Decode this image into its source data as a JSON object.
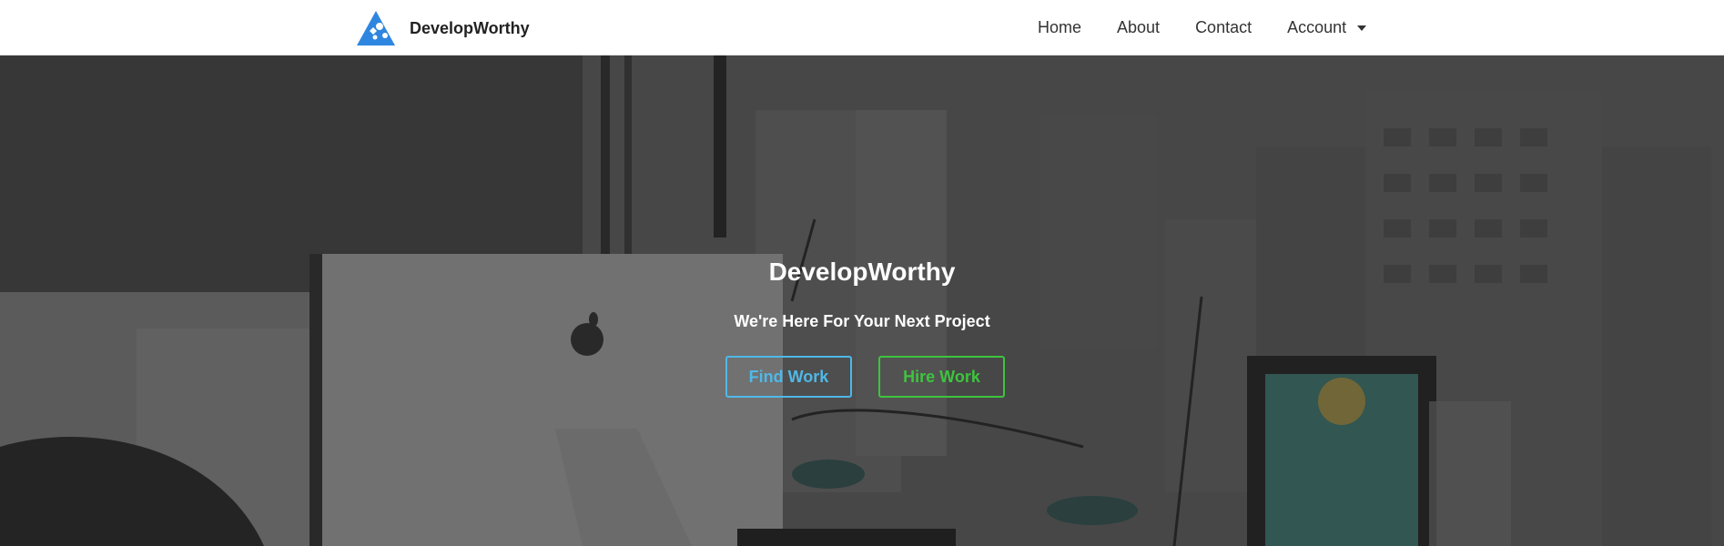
{
  "navbar": {
    "brand_name": "DevelopWorthy",
    "logo_icon": "puzzle-triangle-logo",
    "brand_color": "#2f86e0",
    "links": [
      {
        "label": "Home"
      },
      {
        "label": "About"
      },
      {
        "label": "Contact"
      },
      {
        "label": "Account",
        "has_dropdown": true
      }
    ]
  },
  "hero": {
    "title": "DevelopWorthy",
    "subtitle": "We're Here For Your Next Project",
    "background_description_icon": "office-desk-photo",
    "buttons": {
      "find_work": {
        "label": "Find Work",
        "color": "#4fb8e8"
      },
      "hire_work": {
        "label": "Hire Work",
        "color": "#3ec43e"
      }
    }
  }
}
